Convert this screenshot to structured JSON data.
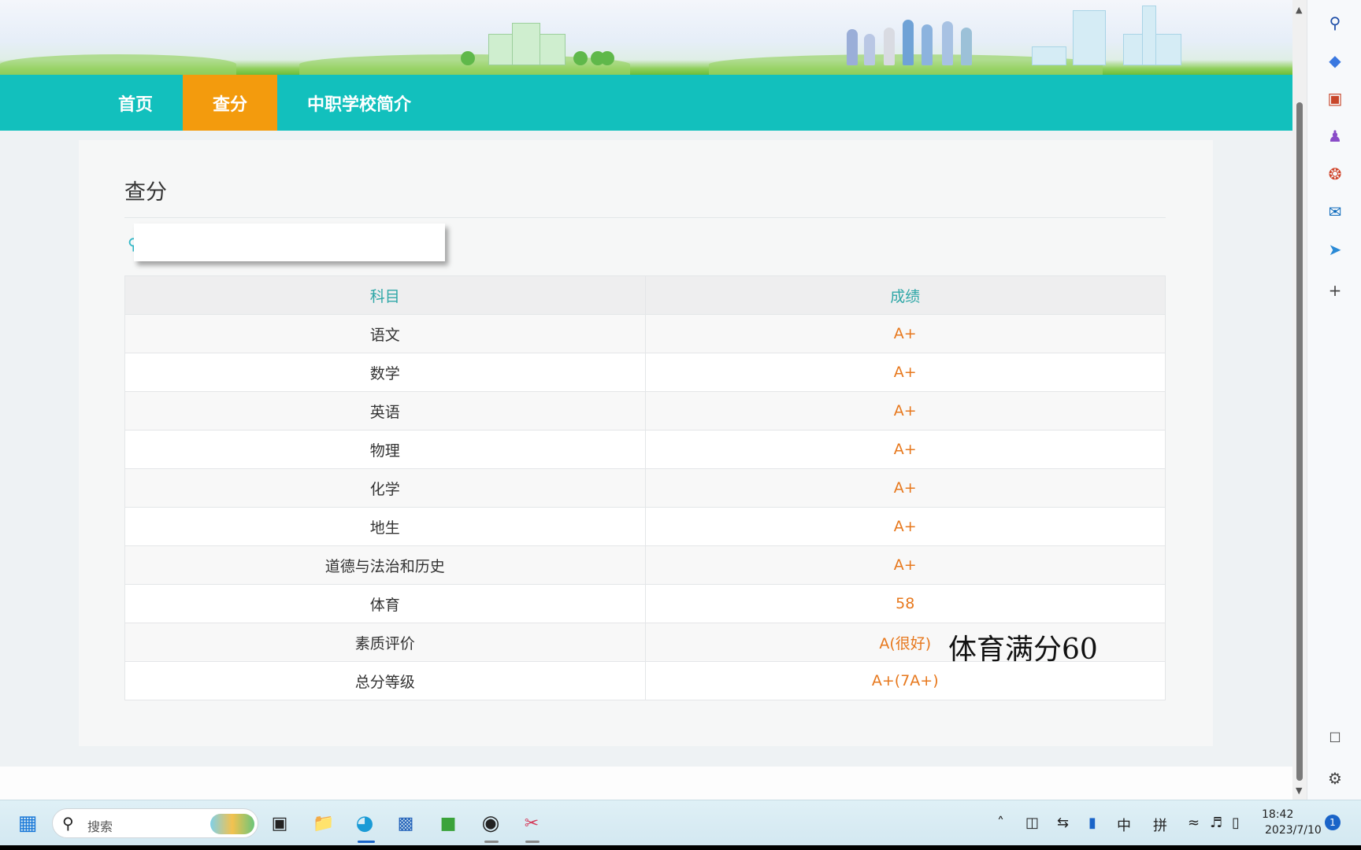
{
  "nav": {
    "items": [
      {
        "label": "首页",
        "active": false
      },
      {
        "label": "查分",
        "active": true
      },
      {
        "label": "中职学校简介",
        "active": false
      }
    ]
  },
  "main": {
    "title": "查分",
    "name_icon": "person-icon",
    "table": {
      "headers": [
        "科目",
        "成绩"
      ],
      "rows": [
        {
          "subject": "语文",
          "grade": "A+"
        },
        {
          "subject": "数学",
          "grade": "A+"
        },
        {
          "subject": "英语",
          "grade": "A+"
        },
        {
          "subject": "物理",
          "grade": "A+"
        },
        {
          "subject": "化学",
          "grade": "A+"
        },
        {
          "subject": "地生",
          "grade": "A+"
        },
        {
          "subject": "道德与法治和历史",
          "grade": "A+"
        },
        {
          "subject": "体育",
          "grade": "58"
        },
        {
          "subject": "素质评价",
          "grade": "A(很好)"
        },
        {
          "subject": "总分等级",
          "grade": "A+(7A+)"
        }
      ]
    },
    "overlay_note": "体育满分60"
  },
  "taskbar": {
    "search_placeholder": "搜索",
    "tray": {
      "input_mode": "中",
      "ime": "拼"
    },
    "clock": {
      "time": "18:42",
      "date": "2023/7/10"
    },
    "notification_count": "1"
  },
  "colors": {
    "nav_bg": "#12c0bd",
    "nav_active": "#f39b0d",
    "header_text": "#2fa7a7",
    "grade_text": "#e7781d"
  },
  "sidebar_icons": [
    "search-icon",
    "tag-icon",
    "briefcase-icon",
    "games-icon",
    "office-icon",
    "outlook-icon",
    "send-icon",
    "add-icon",
    "screenshot-icon",
    "settings-icon"
  ]
}
